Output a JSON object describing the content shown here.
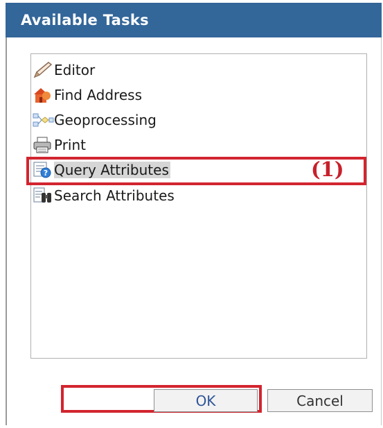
{
  "dialog": {
    "title": "Available Tasks"
  },
  "tasks": [
    {
      "label": "Editor",
      "icon": "pencil-icon"
    },
    {
      "label": "Find Address",
      "icon": "address-house-icon"
    },
    {
      "label": "Geoprocessing",
      "icon": "geoprocessing-flow-icon"
    },
    {
      "label": "Print",
      "icon": "printer-icon"
    },
    {
      "label": "Query Attributes",
      "icon": "query-attributes-icon",
      "selected": true
    },
    {
      "label": "Search Attributes",
      "icon": "search-binoculars-icon"
    }
  ],
  "annotation": {
    "callout": "(1)",
    "color": "#d2252f"
  },
  "buttons": {
    "ok_label": "OK",
    "cancel_label": "Cancel"
  },
  "colors": {
    "titlebar": "#336699",
    "selection": "#d6d6d6"
  }
}
